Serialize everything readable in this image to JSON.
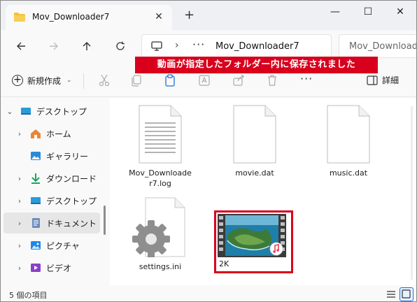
{
  "window": {
    "tab_title": "Mov_Downloader7",
    "new_tab": "+",
    "close_tab": "✕",
    "minimize": "—",
    "maximize": "☐",
    "close": "✕"
  },
  "address": {
    "dots": "···",
    "path": "Mov_Downloader7",
    "search_text": "Mov_Download"
  },
  "commands": {
    "new_label": "新規作成",
    "more": "···",
    "details_label": "詳細"
  },
  "banner": "動画が指定したフォルダー内に保存されました",
  "sidebar": {
    "items": [
      {
        "label": "デスクトップ",
        "icon": "desktop-icon",
        "expanded": true
      },
      {
        "label": "ホーム",
        "icon": "home-icon"
      },
      {
        "label": "ギャラリー",
        "icon": "gallery-icon"
      },
      {
        "label": "ダウンロード",
        "icon": "download-icon"
      },
      {
        "label": "デスクトップ",
        "icon": "desktop-icon"
      },
      {
        "label": "ドキュメント",
        "icon": "document-icon",
        "selected": true
      },
      {
        "label": "ピクチャ",
        "icon": "pictures-icon"
      },
      {
        "label": "ビデオ",
        "icon": "video-icon"
      }
    ]
  },
  "files": [
    {
      "name": "Mov_Downloade\nr7.log",
      "type": "text"
    },
    {
      "name": "movie.dat",
      "type": "blank"
    },
    {
      "name": "music.dat",
      "type": "blank"
    },
    {
      "name": "settings.ini",
      "type": "settings"
    },
    {
      "name": "2K",
      "type": "video"
    }
  ],
  "status": {
    "item_count": "5 個の項目"
  },
  "colors": {
    "banner": "#d8001c",
    "highlight": "#d8001c",
    "folder": "#f5c03a"
  }
}
